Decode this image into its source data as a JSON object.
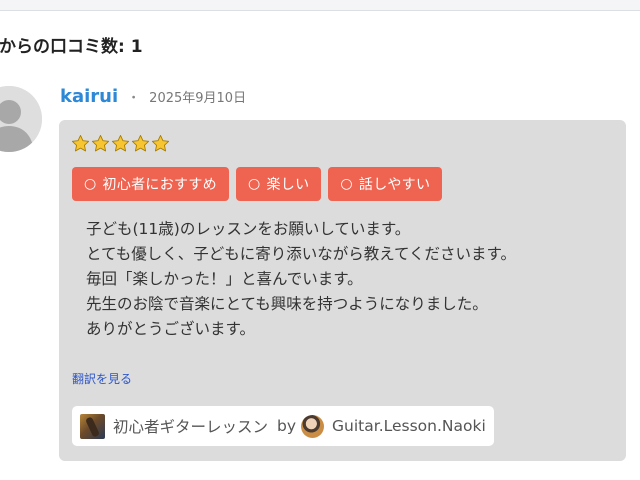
{
  "heading": "からの口コミ数: 1",
  "review": {
    "reviewer_name": "kairui",
    "separator": "・",
    "date": "2025年9月10日",
    "rating": 5,
    "rating_max": 5,
    "tags": [
      {
        "icon": "○",
        "label": "初心者におすすめ"
      },
      {
        "icon": "○",
        "label": "楽しい"
      },
      {
        "icon": "○",
        "label": "話しやすい"
      }
    ],
    "text_lines": [
      "子ども(11歳)のレッスンをお願いしています。",
      "とても優しく、子どもに寄り添いながら教えてくださいます。",
      "毎回「楽しかった！」と喜んでいます。",
      "先生のお陰で音楽にとても興味を持つようになりました。",
      "ありがとうございます。"
    ],
    "translate_link": "翻訳を見る",
    "lesson": {
      "title": "初心者ギターレッスン",
      "by": "by",
      "teacher": "Guitar.Lesson.Naoki"
    }
  },
  "colors": {
    "name_link": "#2d88d6",
    "tag_bg": "#ee6450",
    "card_bg": "#dcdcdc",
    "translate_link": "#2c55c9",
    "star": "#f6c531"
  },
  "icons": {
    "avatar": "default-user-avatar-icon",
    "star": "star-icon"
  }
}
